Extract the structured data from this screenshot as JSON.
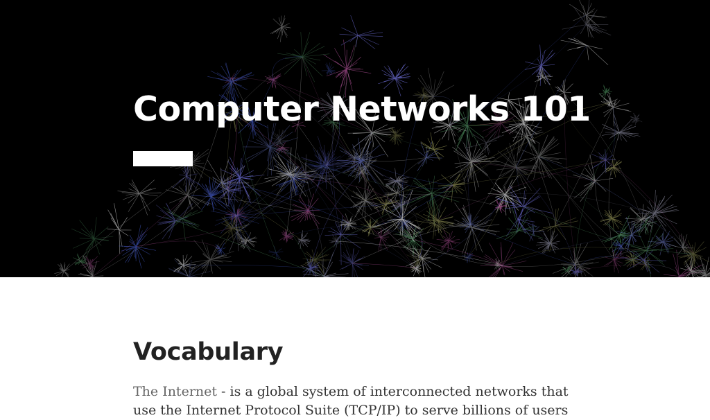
{
  "hero": {
    "title": "Computer Networks 101",
    "background_color": "#000000",
    "accent_color": "#ffffff"
  },
  "content": {
    "section_heading": "Vocabulary",
    "entries": [
      {
        "term": "The Internet",
        "separator": " - ",
        "definition": "is a global system of interconnected networks that use the Internet Protocol Suite (TCP/IP) to serve billions of users"
      }
    ]
  }
}
